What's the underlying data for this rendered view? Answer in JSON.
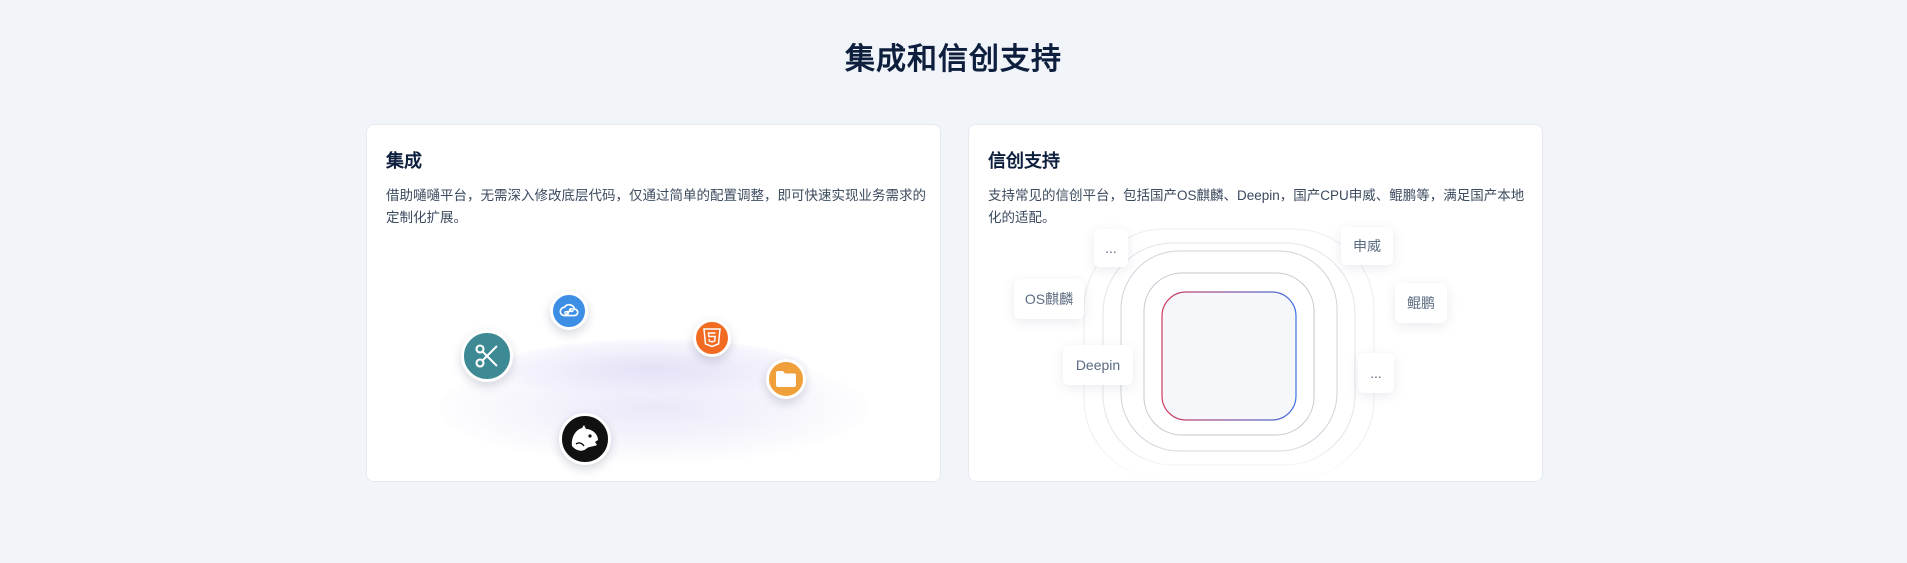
{
  "section": {
    "title": "集成和信创支持"
  },
  "cards": [
    {
      "title": "集成",
      "description": "借助嗵嗵平台，无需深入修改底层代码，仅通过简单的配置调整，即可快速实现业务需求的定制化扩展。",
      "icons": [
        "cloud-link-icon",
        "html5-icon",
        "scissors-icon",
        "folder-icon",
        "wolf-icon"
      ],
      "colors": {
        "cloud": "#3d8fe6",
        "html5": "#f26b22",
        "scissors": "#3e8a94",
        "folder": "#f0a03a",
        "wolf": "#111111"
      }
    },
    {
      "title": "信创支持",
      "description": "支持常见的信创平台，包括国产OS麒麟、Deepin，国产CPU申威、鲲鹏等，满足国产本地化的适配。",
      "chips": {
        "top_left": "...",
        "top_right": "申威",
        "left": "OS麒麟",
        "right": "鲲鹏",
        "bottom_left": "Deepin",
        "bottom_right": "..."
      },
      "colors": {
        "inner_red": "#d23a5a",
        "inner_blue": "#3d6fe0"
      }
    }
  ]
}
